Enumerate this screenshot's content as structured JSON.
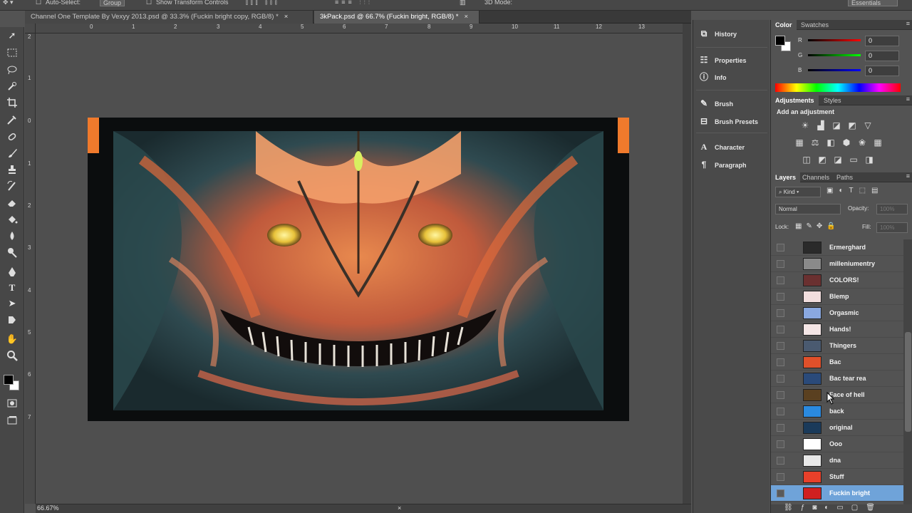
{
  "options_bar": {
    "auto_select_label": "Auto-Select:",
    "auto_select_value": "Group",
    "show_transform_label": "Show Transform Controls",
    "mode_3d_label": "3D Mode:",
    "workspace_label": "Essentials"
  },
  "document_tabs": [
    {
      "label": "Channel One Template By Vexyy 2013.psd @ 33.3% (Fuckin bright copy, RGB/8) *",
      "close": "×"
    },
    {
      "label": "3kPack.psd @ 66.7% (Fuckin bright, RGB/8) *",
      "close": "×"
    }
  ],
  "ruler_h": [
    "0",
    "1",
    "2",
    "3",
    "4",
    "5",
    "6",
    "7",
    "8",
    "9",
    "10",
    "11",
    "12",
    "13"
  ],
  "ruler_v": [
    "2",
    "1",
    "0",
    "1",
    "2",
    "3",
    "4",
    "5",
    "6",
    "7"
  ],
  "status_bar": {
    "zoom": "66.67%",
    "close": "×"
  },
  "panel_strip": [
    {
      "label": "History",
      "icon": "history-icon"
    },
    {
      "label": "Properties",
      "icon": "properties-icon"
    },
    {
      "label": "Info",
      "icon": "info-icon"
    },
    {
      "label": "Brush",
      "icon": "brush-icon"
    },
    {
      "label": "Brush Presets",
      "icon": "brush-presets-icon"
    },
    {
      "label": "Character",
      "icon": "character-icon"
    },
    {
      "label": "Paragraph",
      "icon": "paragraph-icon"
    }
  ],
  "color_panel": {
    "tabs": [
      "Color",
      "Swatches"
    ],
    "r_label": "R",
    "g_label": "G",
    "b_label": "B",
    "r": "0",
    "g": "0",
    "b": "0",
    "foreground": "#000000",
    "background": "#ffffff"
  },
  "adjustments_panel": {
    "tabs": [
      "Adjustments",
      "Styles"
    ],
    "add_label": "Add an adjustment"
  },
  "layers_panel": {
    "tabs": [
      "Layers",
      "Channels",
      "Paths"
    ],
    "kind_label": "Kind",
    "blend_mode": "Normal",
    "opacity_label": "Opacity:",
    "opacity_value": "100%",
    "lock_label": "Lock:",
    "fill_label": "Fill:",
    "fill_value": "100%",
    "layers": [
      {
        "name": "Ermerghard",
        "thumb": "#2a2a2a",
        "selected": false
      },
      {
        "name": "milleniumentry",
        "thumb": "#8a8a8a",
        "selected": false
      },
      {
        "name": "COLORS!",
        "thumb": "#6a3030",
        "selected": false
      },
      {
        "name": "Blemp",
        "thumb": "#f2dede",
        "selected": false
      },
      {
        "name": "Orgasmic",
        "thumb": "#8aa8e0",
        "selected": false
      },
      {
        "name": "Hands!",
        "thumb": "#f5e6e6",
        "selected": false
      },
      {
        "name": "Thingers",
        "thumb": "#4a5a70",
        "selected": false
      },
      {
        "name": "Bac",
        "thumb": "#e0502a",
        "selected": false
      },
      {
        "name": "Bac tear rea",
        "thumb": "#2a4a7a",
        "selected": false
      },
      {
        "name": "Face of hell",
        "thumb": "#5a4020",
        "selected": false
      },
      {
        "name": "back",
        "thumb": "#2a8ae0",
        "selected": false
      },
      {
        "name": "original",
        "thumb": "#1a3a5a",
        "selected": false
      },
      {
        "name": "Ooo",
        "thumb": "#ffffff",
        "selected": false
      },
      {
        "name": "dna",
        "thumb": "#e8e8e8",
        "selected": false
      },
      {
        "name": "Stuff",
        "thumb": "#e8402a",
        "selected": false
      },
      {
        "name": "Fuckin bright",
        "thumb": "#d02020",
        "selected": true
      }
    ]
  }
}
